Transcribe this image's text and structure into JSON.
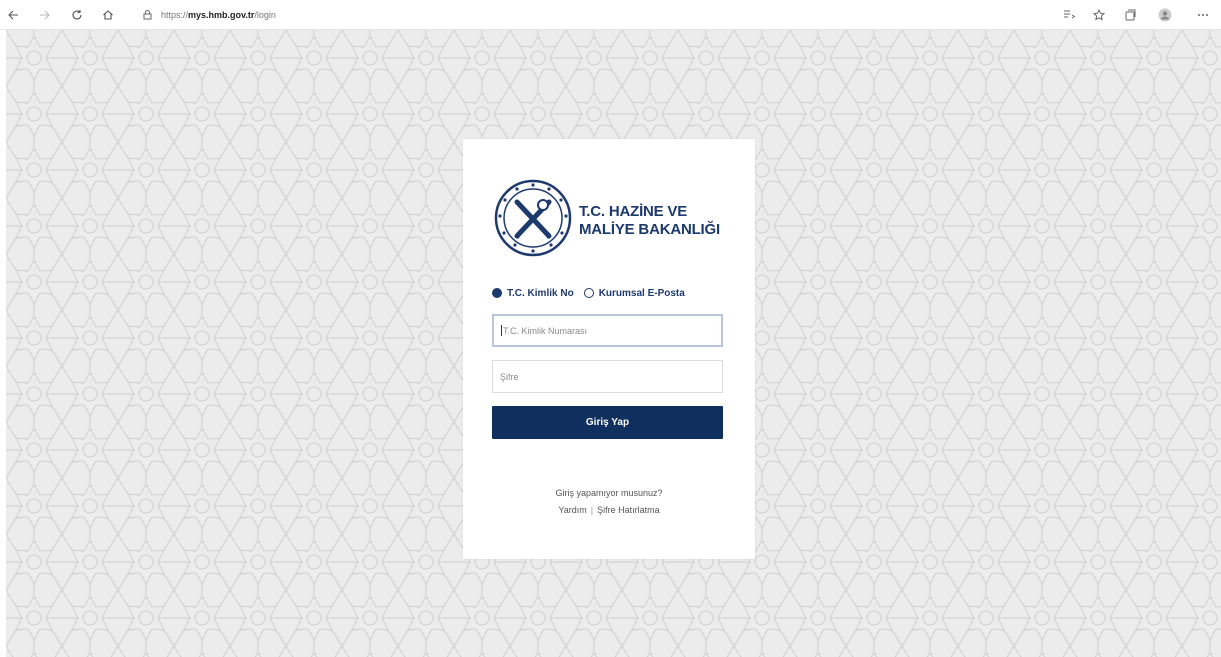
{
  "browser": {
    "url_scheme": "https://",
    "url_host": "mys.hmb.gov.tr",
    "url_path": "/login",
    "icons": [
      "back-icon",
      "forward-icon",
      "refresh-icon",
      "home-icon",
      "lock-icon",
      "reading-view-icon",
      "favorites-icon",
      "collections-icon",
      "profile-icon",
      "more-icon"
    ]
  },
  "brand": {
    "line1": "T.C. HAZİNE VE",
    "line2": "MALİYE BAKANLIĞI",
    "color": "#1d3a6e"
  },
  "login": {
    "radio_tc": "T.C. Kimlik No",
    "radio_email": "Kurumsal E-Posta",
    "selected": "tc",
    "tc_placeholder": "T.C. Kimlik Numarası",
    "password_placeholder": "Şifre",
    "submit_label": "Giriş Yap",
    "submit_color": "#0f305f"
  },
  "help": {
    "question": "Giriş yapamıyor musunuz?",
    "help_link": "Yardım",
    "separator": "|",
    "reset_link": "Şifre Hatırlatma"
  }
}
